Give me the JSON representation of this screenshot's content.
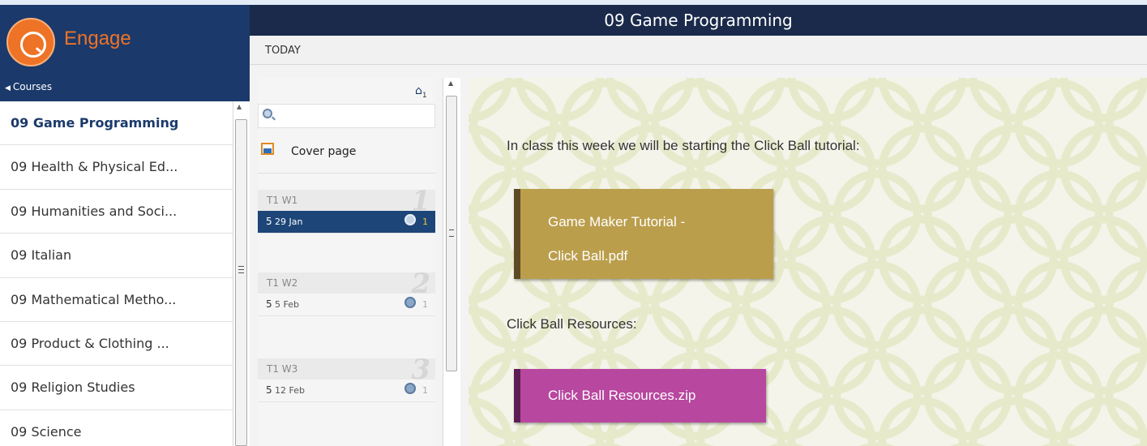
{
  "brand": {
    "name": "Engage"
  },
  "nav": {
    "back_label": "Courses"
  },
  "courses": [
    {
      "label": "09 Game Programming"
    },
    {
      "label": "09 Health & Physical Ed..."
    },
    {
      "label": "09 Humanities and Soci..."
    },
    {
      "label": "09 Italian"
    },
    {
      "label": "09 Mathematical Metho..."
    },
    {
      "label": "09 Product & Clothing ..."
    },
    {
      "label": "09 Religion Studies"
    },
    {
      "label": "09 Science"
    }
  ],
  "header": {
    "title": "09 Game Programming",
    "today_label": "TODAY"
  },
  "timeline": {
    "home_badge": "1",
    "search_placeholder": "",
    "cover_label": "Cover page",
    "weeks": [
      {
        "label": "T1  W1",
        "number": "1",
        "day_num": "5",
        "date": "29 Jan",
        "count": "1",
        "selected": true
      },
      {
        "label": "T1  W2",
        "number": "2",
        "day_num": "5",
        "date": "5 Feb",
        "count": "1",
        "selected": false
      },
      {
        "label": "T1  W3",
        "number": "3",
        "day_num": "5",
        "date": "12 Feb",
        "count": "1",
        "selected": false
      }
    ]
  },
  "content": {
    "intro": "In class this week we will be starting the Click Ball tutorial:",
    "file_1_line_1": "Game Maker Tutorial -",
    "file_1_line_2": "Click Ball.pdf",
    "resources_heading": "Click Ball Resources:",
    "file_2": "Click Ball Resources.zip"
  },
  "colors": {
    "header_bg": "#1b2a4b",
    "brand_bg": "#1b3a6b",
    "brand_orange": "#ee7326",
    "selected_day": "#1d4577",
    "file_gold": "#bb9e4c",
    "file_magenta": "#b8479f"
  }
}
